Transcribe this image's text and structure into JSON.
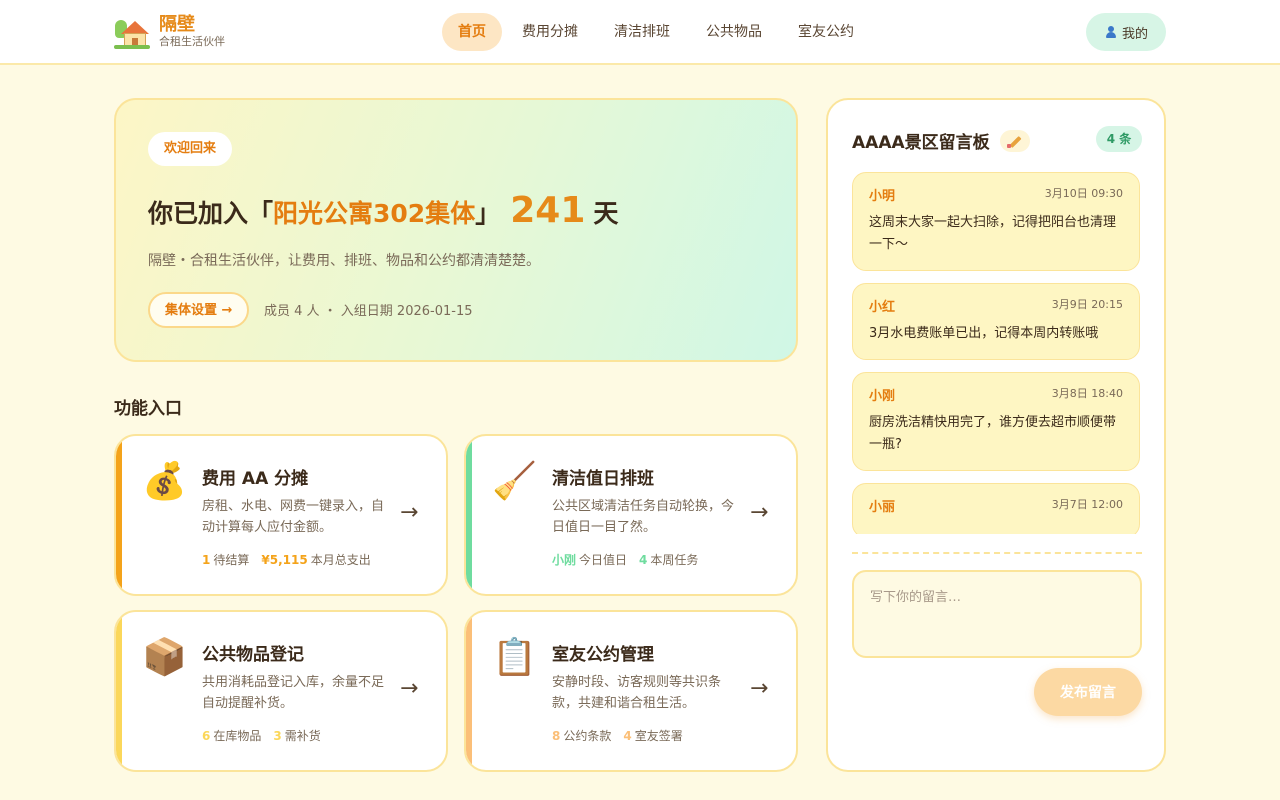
{
  "brand": {
    "title": "隔壁",
    "subtitle": "合租生活伙伴"
  },
  "nav": [
    {
      "label": "首页",
      "active": true
    },
    {
      "label": "费用分摊"
    },
    {
      "label": "清洁排班"
    },
    {
      "label": "公共物品"
    },
    {
      "label": "室友公约"
    }
  ],
  "user_menu": {
    "label": "我的",
    "icon": "person-icon"
  },
  "hero": {
    "welcome": "欢迎回来",
    "title_prefix": "你已加入「",
    "group_name": "阳光公寓302集体",
    "title_suffix": "」",
    "days": "241",
    "days_unit": "天",
    "description": "隔壁・合租生活伙伴，让费用、排班、物品和公约都清清楚楚。",
    "settings_button": "集体设置 →",
    "meta": "成员 4 人 ・ 入组日期 2026-01-15"
  },
  "features_title": "功能入口",
  "features": [
    {
      "icon": "money-bag-icon",
      "emoji": "💰",
      "title": "费用 AA 分摊",
      "description": "房租、水电、网费一键录入，自动计算每人应付金额。",
      "stats": [
        {
          "value": "1",
          "label": "待结算"
        },
        {
          "value": "¥5,115",
          "label": "本月总支出"
        }
      ],
      "accent": "#f4a31a"
    },
    {
      "icon": "broom-icon",
      "emoji": "🧹",
      "title": "清洁值日排班",
      "description": "公共区域清洁任务自动轮换，今日值日一目了然。",
      "stats": [
        {
          "value": "小刚",
          "label": "今日值日"
        },
        {
          "value": "4",
          "label": "本周任务"
        }
      ],
      "accent": "#6fdc9f"
    },
    {
      "icon": "package-icon",
      "emoji": "📦",
      "title": "公共物品登记",
      "description": "共用消耗品登记入库，余量不足自动提醒补货。",
      "stats": [
        {
          "value": "6",
          "label": "在库物品"
        },
        {
          "value": "3",
          "label": "需补货"
        }
      ],
      "accent": "#fbd75a"
    },
    {
      "icon": "clipboard-icon",
      "emoji": "📋",
      "title": "室友公约管理",
      "description": "安静时段、访客规则等共识条款，共建和谐合租生活。",
      "stats": [
        {
          "value": "8",
          "label": "公约条款"
        },
        {
          "value": "4",
          "label": "室友签署"
        }
      ],
      "accent": "#fbbf78"
    }
  ],
  "board": {
    "title": "AAAA景区留言板",
    "count": "4 条",
    "messages": [
      {
        "author": "小明",
        "time": "3月10日 09:30",
        "text": "这周末大家一起大扫除，记得把阳台也清理一下～"
      },
      {
        "author": "小红",
        "time": "3月9日 20:15",
        "text": "3月水电费账单已出，记得本周内转账哦"
      },
      {
        "author": "小刚",
        "time": "3月8日 18:40",
        "text": "厨房洗洁精快用完了，谁方便去超市顺便带一瓶?"
      },
      {
        "author": "小丽",
        "time": "3月7日 12:00",
        "text": ""
      }
    ],
    "input_placeholder": "写下你的留言…",
    "post_button": "发布留言"
  },
  "colors": {
    "accent": "#e47d10",
    "background": "#fefae3",
    "border": "#fbe49a"
  }
}
